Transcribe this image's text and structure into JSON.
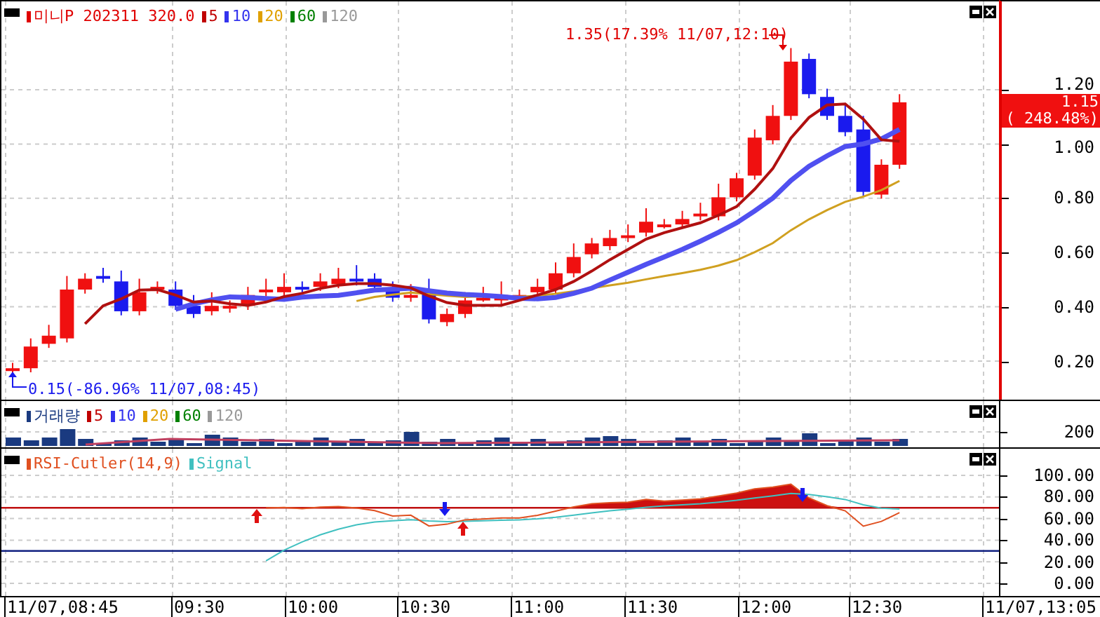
{
  "price_panel": {
    "legend": [
      {
        "label": "미니P 202311 320.0",
        "color": "#e00000"
      },
      {
        "label": "5",
        "color": "#c00000"
      },
      {
        "label": "10",
        "color": "#3333ee"
      },
      {
        "label": "20",
        "color": "#e0a000"
      },
      {
        "label": "60",
        "color": "#008000"
      },
      {
        "label": "120",
        "color": "#999999"
      }
    ],
    "high_note": "1.35(17.39% 11/07,12:10)",
    "low_note": "0.15(-86.96% 11/07,08:45)",
    "axis_labels": [
      "1.20",
      "1.00",
      "0.80",
      "0.60",
      "0.40",
      "0.20"
    ],
    "current_price": "1.15",
    "current_change": "( 248.48%)"
  },
  "volume_panel": {
    "legend": [
      {
        "label": "거래량",
        "color": "#1a3a80"
      },
      {
        "label": "5",
        "color": "#c00000"
      },
      {
        "label": "10",
        "color": "#3333ee"
      },
      {
        "label": "20",
        "color": "#e0a000"
      },
      {
        "label": "60",
        "color": "#008000"
      },
      {
        "label": "120",
        "color": "#999999"
      }
    ],
    "axis_labels": [
      "200"
    ]
  },
  "rsi_panel": {
    "legend": [
      {
        "label": "RSI-Cutler(14,9)",
        "color": "#e05020"
      },
      {
        "label": "Signal",
        "color": "#40c0c0"
      }
    ],
    "axis_labels": [
      "100.00",
      "80.00",
      "60.00",
      "40.00",
      "20.00",
      "0.00"
    ]
  },
  "time_axis": [
    "11/07,08:45",
    "09:30",
    "10:00",
    "10:30",
    "11:00",
    "11:30",
    "12:00",
    "12:30",
    "11/07,13:05"
  ]
}
